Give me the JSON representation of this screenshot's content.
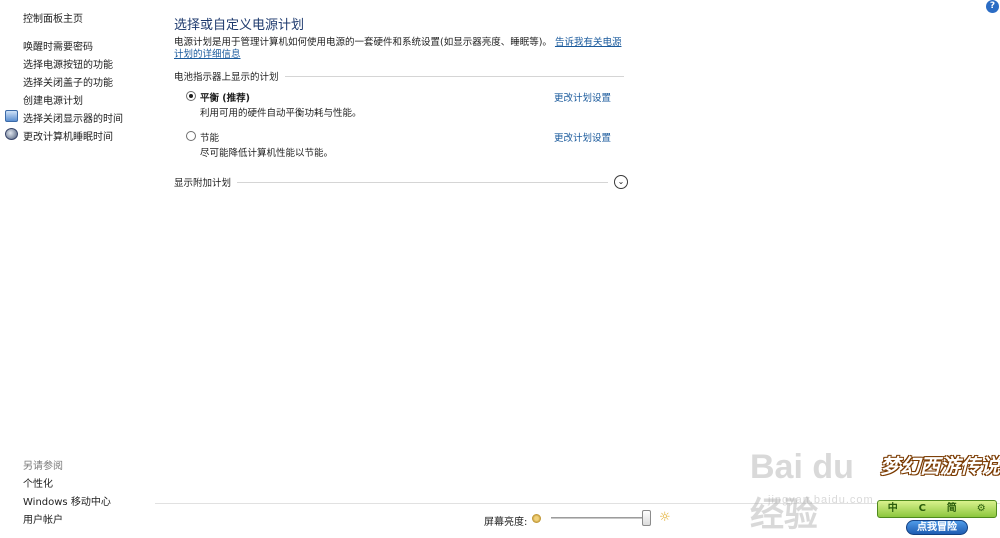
{
  "help_icon": "help-question-icon",
  "sidebar": {
    "home": "控制面板主页",
    "items": [
      {
        "label": "唤醒时需要密码",
        "icon": null
      },
      {
        "label": "选择电源按钮的功能",
        "icon": null
      },
      {
        "label": "选择关闭盖子的功能",
        "icon": null
      },
      {
        "label": "创建电源计划",
        "icon": null
      },
      {
        "label": "选择关闭显示器的时间",
        "icon": "monitor-icon"
      },
      {
        "label": "更改计算机睡眠时间",
        "icon": "moon-icon"
      }
    ],
    "see_also": {
      "heading": "另请参阅",
      "items": [
        "个性化",
        "Windows 移动中心",
        "用户帐户"
      ]
    }
  },
  "main": {
    "title": "选择或自定义电源计划",
    "intro_text": "电源计划是用于管理计算机如何使用电源的一套硬件和系统设置(如显示器亮度、睡眠等)。",
    "intro_link": "告诉我有关电源计划的详细信息",
    "section_header": "电池指示器上显示的计划",
    "plans": [
      {
        "name": "平衡 (推荐)",
        "description": "利用可用的硬件自动平衡功耗与性能。",
        "link": "更改计划设置",
        "selected": true
      },
      {
        "name": "节能",
        "description": "尽可能降低计算机性能以节能。",
        "link": "更改计划设置",
        "selected": false
      }
    ],
    "more_plans": "显示附加计划",
    "expand_icon": "chevron-down-icon"
  },
  "bottom": {
    "brightness_label": "屏幕亮度:",
    "brightness_value_fraction": 0.95
  },
  "watermark": {
    "main": "Bai du 经验",
    "sub": "jingyan.baidu.com"
  },
  "game_widget": {
    "logo_text": "梦幻西游传说",
    "toolbar_buttons": [
      "中",
      "C",
      "简",
      "⚙"
    ],
    "adventure_button": "点我冒险"
  },
  "colors": {
    "title": "#1e3a6e",
    "link": "#1a5a9c",
    "game_green": "#8cc63e",
    "game_blue": "#1e5cb2"
  }
}
